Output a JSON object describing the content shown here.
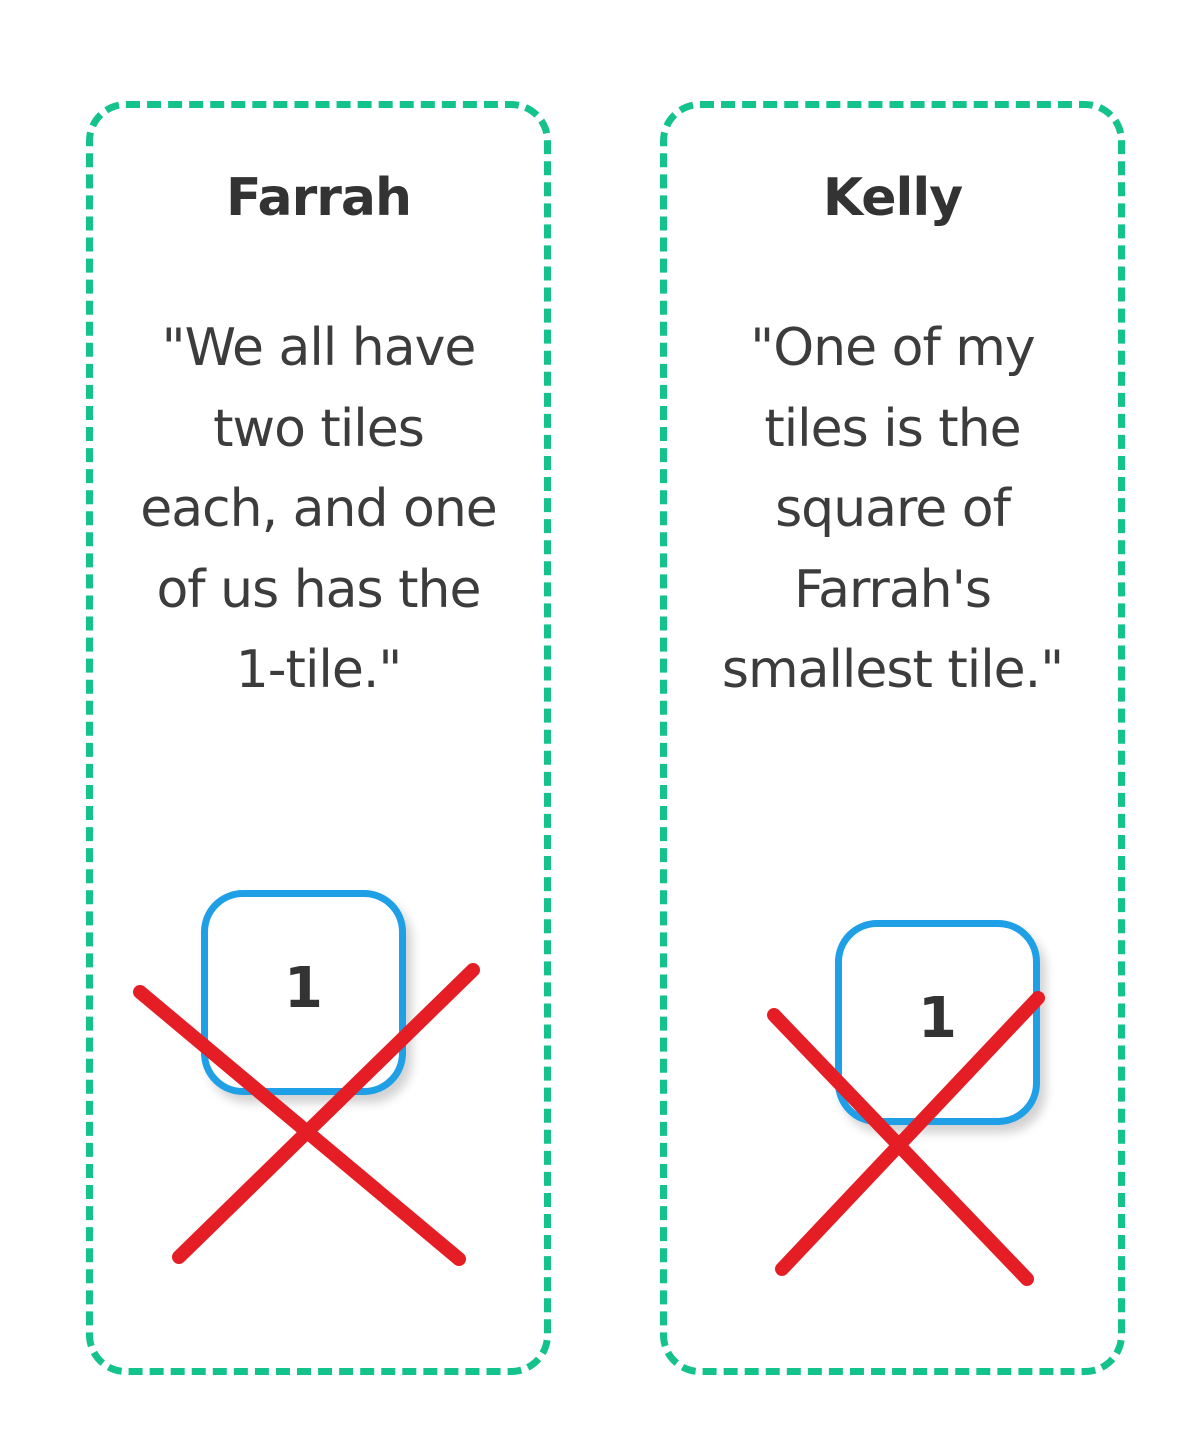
{
  "cards": [
    {
      "name": "Farrah",
      "quote": "\"We all have two tiles each, and one of us has the 1-tile.\"",
      "tile": {
        "value": "1",
        "crossed_out": true
      }
    },
    {
      "name": "Kelly",
      "quote": "\"One of my tiles is the square of Farrah's smallest tile.\"",
      "tile": {
        "value": "1",
        "crossed_out": true
      }
    }
  ],
  "colors": {
    "card_border": "#14c28c",
    "tile_border": "#1e9fe6",
    "cross": "#e51e25",
    "text": "#333333"
  }
}
